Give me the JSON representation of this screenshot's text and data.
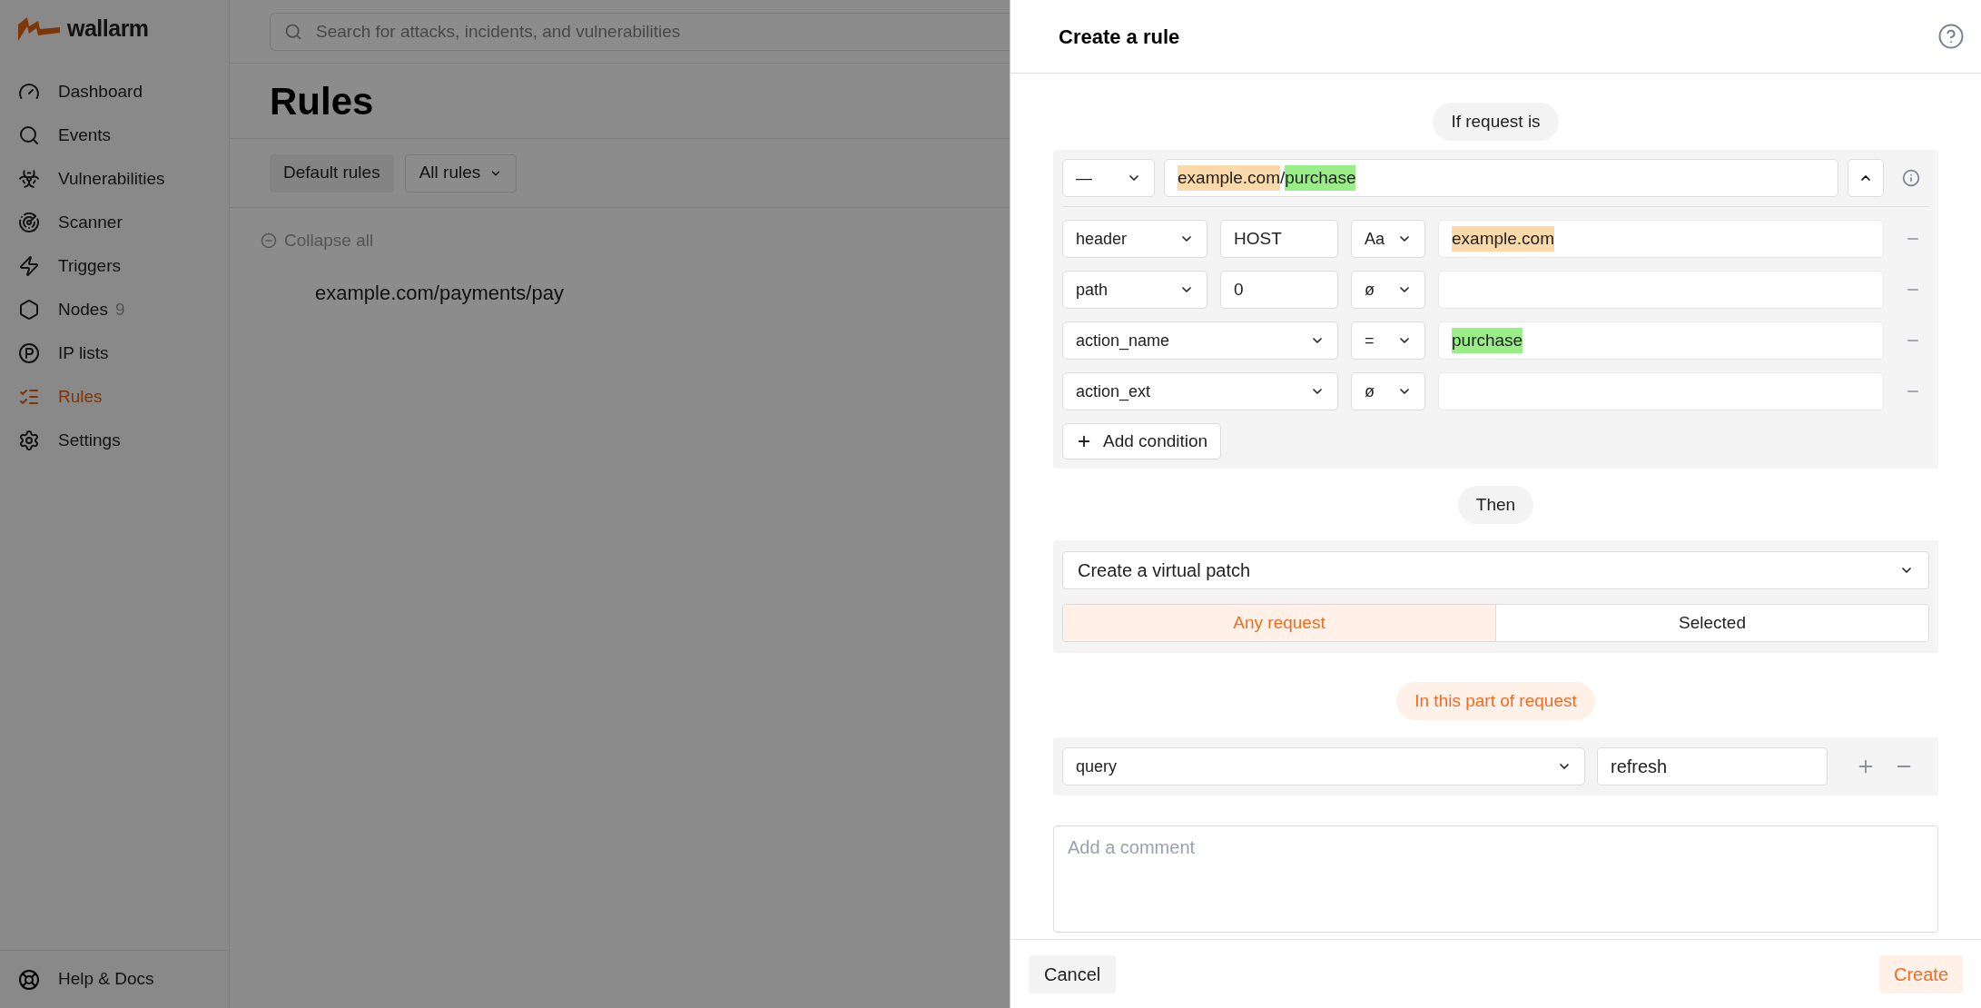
{
  "brand": "wallarm",
  "sidebar": {
    "items": [
      {
        "label": "Dashboard",
        "selected": false
      },
      {
        "label": "Events",
        "selected": false
      },
      {
        "label": "Vulnerabilities",
        "selected": false
      },
      {
        "label": "Scanner",
        "selected": false
      },
      {
        "label": "Triggers",
        "selected": false
      },
      {
        "label": "Nodes",
        "count": "9",
        "selected": false
      },
      {
        "label": "IP lists",
        "selected": false
      },
      {
        "label": "Rules",
        "selected": true
      },
      {
        "label": "Settings",
        "selected": false
      }
    ],
    "footer": "Help & Docs"
  },
  "search": {
    "placeholder": "Search for attacks, incidents, and vulnerabilities"
  },
  "page": {
    "title": "Rules",
    "default_button": "Default rules",
    "filter": "All rules",
    "collapse": "Collapse all",
    "rule_path": "example.com/payments/pay"
  },
  "drawer": {
    "title": "Create a rule",
    "if_label": "If request is",
    "path_operator": "—",
    "path_segments": [
      {
        "text": "example.com",
        "kind": "host"
      },
      {
        "text": "/",
        "kind": "plain"
      },
      {
        "text": "purchase",
        "kind": "action"
      }
    ],
    "conditions": [
      {
        "kind": "keyed",
        "field": "header",
        "key": "HOST",
        "operator": "Aa",
        "value": {
          "text": "example.com",
          "kind": "host"
        }
      },
      {
        "kind": "keyed",
        "field": "path",
        "key": "0",
        "operator": "ø"
      },
      {
        "kind": "plain",
        "field": "action_name",
        "operator": "=",
        "value": {
          "text": "purchase",
          "kind": "action"
        }
      },
      {
        "kind": "plain",
        "field": "action_ext",
        "operator": "ø"
      }
    ],
    "add_condition": "Add condition",
    "then_label": "Then",
    "action": "Create a virtual patch",
    "scope_tabs": [
      {
        "label": "Any request",
        "selected": true
      },
      {
        "label": "Selected",
        "selected": false
      }
    ],
    "part_label": "In this part of request",
    "part": {
      "field": "query",
      "value": "refresh"
    },
    "comment_placeholder": "Add a comment",
    "cancel": "Cancel",
    "create": "Create"
  }
}
